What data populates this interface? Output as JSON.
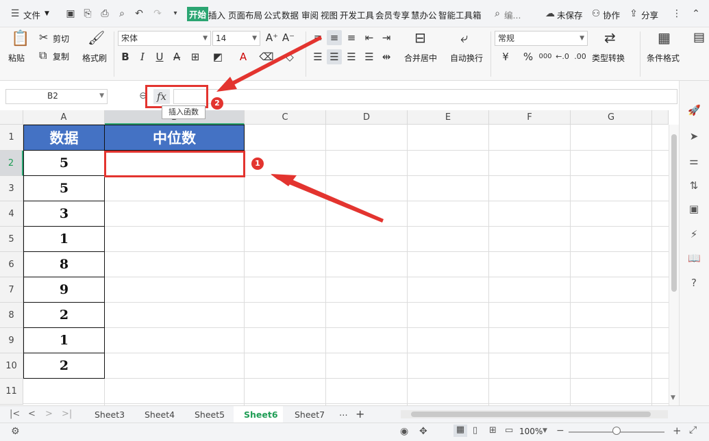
{
  "menubar": {
    "file_label": "文件",
    "tabs": [
      "开始",
      "插入",
      "页面布局",
      "公式",
      "数据",
      "审阅",
      "视图",
      "开发工具",
      "会员专享",
      "慧办公",
      "智能工具箱"
    ],
    "search_placeholder": "编...",
    "unsaved": "未保存",
    "collab": "协作",
    "share": "分享"
  },
  "ribbon": {
    "paste": "粘贴",
    "cut": "剪切",
    "copy": "复制",
    "format_painter": "格式刷",
    "font_name": "宋体",
    "font_size": "14",
    "merge_center": "合并居中",
    "wrap_text": "自动换行",
    "number_format": "常规",
    "type_convert": "类型转换",
    "conditional_format": "条件格式",
    "bold": "B",
    "italic": "I",
    "underline": "U",
    "percent": "%",
    "thousands": "000"
  },
  "formula_bar": {
    "name_box": "B2",
    "fx_label": "fx",
    "tooltip": "插入函数"
  },
  "columns": [
    "A",
    "B",
    "C",
    "D",
    "E",
    "F",
    "G"
  ],
  "rows": [
    "1",
    "2",
    "3",
    "4",
    "5",
    "6",
    "7",
    "8",
    "9",
    "10",
    "11"
  ],
  "sheet": {
    "header_a": "数据",
    "header_b": "中位数",
    "values": [
      "5",
      "5",
      "3",
      "1",
      "8",
      "9",
      "2",
      "1",
      "2"
    ]
  },
  "annotations": {
    "badge1": "1",
    "badge2": "2",
    "accent": "#e3342f"
  },
  "tabs": {
    "sheets": [
      "Sheet3",
      "Sheet4",
      "Sheet5",
      "Sheet6",
      "Sheet7"
    ],
    "active": "Sheet6",
    "more": "⋯",
    "add": "+"
  },
  "status": {
    "zoom": "100%"
  }
}
